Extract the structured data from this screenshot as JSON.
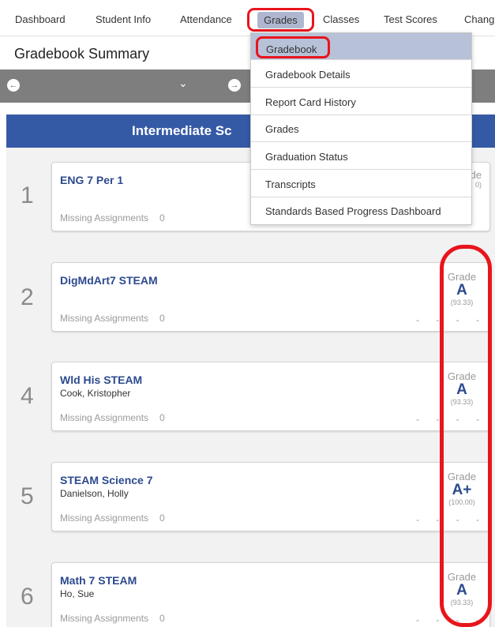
{
  "nav": {
    "items": [
      "Dashboard",
      "Student Info",
      "Attendance",
      "Grades",
      "Classes",
      "Test Scores",
      "Chang"
    ],
    "active": "Grades"
  },
  "page": {
    "title": "Gradebook Summary"
  },
  "toolbar": {
    "prev_icon": "arrow-left-icon",
    "dropdown_icon": "chevron-down-icon",
    "next_icon": "arrow-right-icon"
  },
  "school": {
    "name": "Intermediate Sc"
  },
  "dropdown": {
    "items": [
      "Gradebook",
      "Gradebook Details",
      "Report Card History",
      "Grades",
      "Graduation Status",
      "Transcripts",
      "Standards Based Progress Dashboard"
    ]
  },
  "labels": {
    "missing": "Missing Assignments",
    "grade": "Grade",
    "grade_partial": "de",
    "dashes": "- - - -"
  },
  "courses": [
    {
      "period": "1",
      "name": "ENG 7 Per 1",
      "teacher": "",
      "missing": "0",
      "grade": "",
      "pct": "0)"
    },
    {
      "period": "2",
      "name": "DigMdArt7 STEAM",
      "teacher": "",
      "missing": "0",
      "grade": "A",
      "pct": "(93.33)"
    },
    {
      "period": "4",
      "name": "Wld His STEAM",
      "teacher": "Cook, Kristopher",
      "missing": "0",
      "grade": "A",
      "pct": "(93.33)"
    },
    {
      "period": "5",
      "name": "STEAM Science 7",
      "teacher": "Danielson, Holly",
      "missing": "0",
      "grade": "A+",
      "pct": "(100.00)"
    },
    {
      "period": "6",
      "name": "Math 7 STEAM",
      "teacher": "Ho, Sue",
      "missing": "0",
      "grade": "A",
      "pct": "(93.33)"
    }
  ],
  "colors": {
    "accent": "#355aa5",
    "course_text": "#2c4a8e",
    "annotation": "#e8151c",
    "toolbar": "#7e7e7e",
    "active_menu": "#b7c1d8"
  }
}
